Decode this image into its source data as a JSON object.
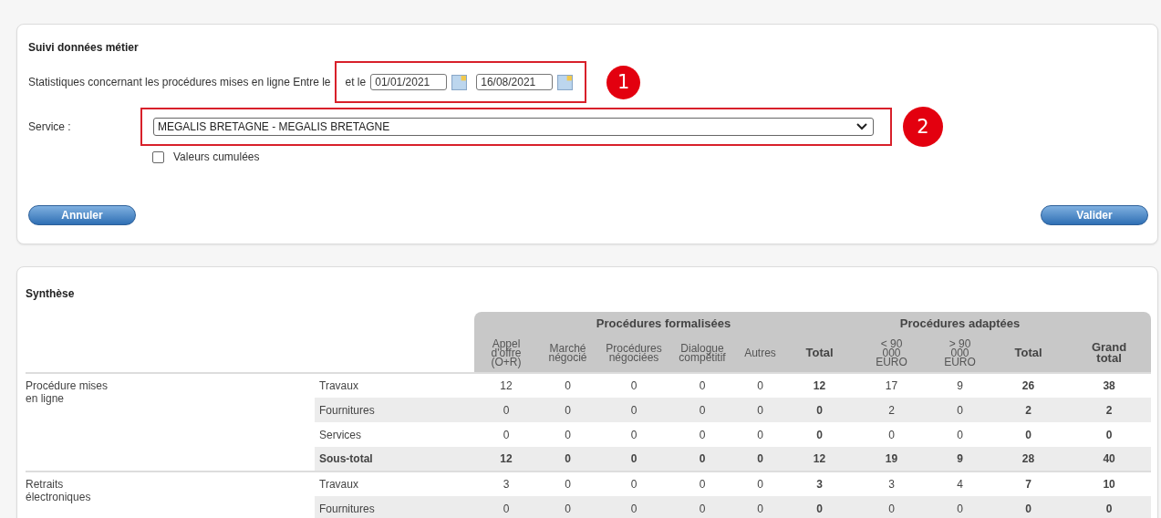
{
  "criteria_panel": {
    "title": "Suivi données métier",
    "period_label": "Statistiques concernant les procédures mises en ligne Entre le",
    "period_join": "et le",
    "date_from": "01/01/2021",
    "date_to": "16/08/2021",
    "service_label": "Service :",
    "service_value": "MEGALIS BRETAGNE - MEGALIS BRETAGNE",
    "cumulative": {
      "label": "Valeurs cumulées",
      "checked": false
    },
    "buttons": [
      "Annuler",
      "Valider"
    ]
  },
  "callouts": [
    "1",
    "2"
  ],
  "summary": {
    "title": "Synthèse",
    "column_groups": [
      {
        "label": "Procédures formalisées",
        "columns": [
          {
            "label": "Appel d'offre (O+R)",
            "bold": false
          },
          {
            "label": "Marché négocié",
            "bold": false
          },
          {
            "label": "Procédures négociées",
            "bold": false
          },
          {
            "label": "Dialogue compétitif",
            "bold": false
          },
          {
            "label": "Autres",
            "bold": false
          },
          {
            "label": "Total",
            "bold": true
          }
        ]
      },
      {
        "label": "Procédures adaptées",
        "columns": [
          {
            "label": "< 90 000 EURO",
            "bold": false
          },
          {
            "label": "> 90 000 EURO",
            "bold": false
          },
          {
            "label": "Total",
            "bold": true
          }
        ]
      },
      {
        "columns": [
          {
            "label": "Grand total",
            "bold": true
          }
        ]
      }
    ],
    "groups": [
      {
        "label": "Procédure mises en ligne",
        "rows": [
          {
            "label": "Travaux",
            "kind": "detail",
            "values": [
              "12",
              "0",
              "0",
              "0",
              "0",
              "12",
              "17",
              "9",
              "26",
              "38"
            ]
          },
          {
            "label": "Fournitures",
            "kind": "detail",
            "values": [
              "0",
              "0",
              "0",
              "0",
              "0",
              "0",
              "2",
              "0",
              "2",
              "2"
            ]
          },
          {
            "label": "Services",
            "kind": "detail",
            "values": [
              "0",
              "0",
              "0",
              "0",
              "0",
              "0",
              "0",
              "0",
              "0",
              "0"
            ]
          },
          {
            "label": "Sous-total",
            "kind": "subtotal",
            "values": [
              "12",
              "0",
              "0",
              "0",
              "0",
              "12",
              "19",
              "9",
              "28",
              "40"
            ]
          }
        ]
      },
      {
        "label": "Retraits électroniques",
        "rows": [
          {
            "label": "Travaux",
            "kind": "detail",
            "values": [
              "3",
              "0",
              "0",
              "0",
              "0",
              "3",
              "3",
              "4",
              "7",
              "10"
            ]
          },
          {
            "label": "Fournitures",
            "kind": "detail",
            "values": [
              "0",
              "0",
              "0",
              "0",
              "0",
              "0",
              "0",
              "0",
              "0",
              "0"
            ]
          }
        ]
      }
    ]
  }
}
